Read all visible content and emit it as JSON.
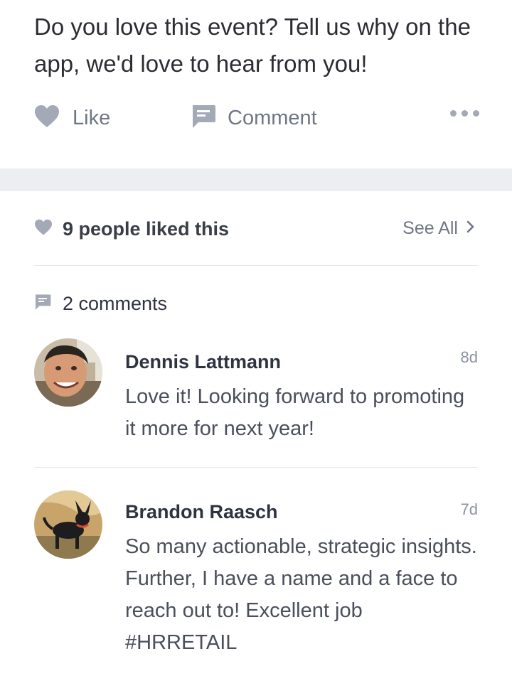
{
  "post": {
    "text": "Do you love this event? Tell us why on the app, we'd love to hear from you!",
    "actions": {
      "like_label": "Like",
      "comment_label": "Comment",
      "more_icon": "more-horizontal-icon"
    }
  },
  "likes": {
    "summary": "9 people liked this",
    "see_all_label": "See All"
  },
  "comments": {
    "header": "2 comments",
    "items": [
      {
        "author": "Dennis Lattmann",
        "time": "8d",
        "text": "Love it!  Looking forward to promoting it more for next year!"
      },
      {
        "author": "Brandon Raasch",
        "time": "7d",
        "text": "So many actionable, strategic insights. Further, I have a name and a face to reach out to! Excellent job #HRRETAIL"
      }
    ]
  },
  "colors": {
    "icon": "#a3a9b7",
    "muted_text": "#6f7686",
    "band": "#eceef2"
  }
}
